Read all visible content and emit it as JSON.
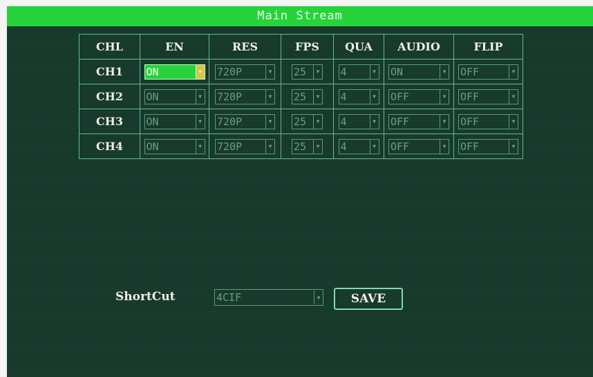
{
  "title": "Main Stream",
  "columns": [
    "CHL",
    "EN",
    "RES",
    "FPS",
    "QUA",
    "AUDIO",
    "FLIP"
  ],
  "rows": [
    {
      "channel": "CH1",
      "en": "ON",
      "res": "720P",
      "fps": "25",
      "qua": "4",
      "audio": "ON",
      "flip": "OFF"
    },
    {
      "channel": "CH2",
      "en": "ON",
      "res": "720P",
      "fps": "25",
      "qua": "4",
      "audio": "OFF",
      "flip": "OFF"
    },
    {
      "channel": "CH3",
      "en": "ON",
      "res": "720P",
      "fps": "25",
      "qua": "4",
      "audio": "OFF",
      "flip": "OFF"
    },
    {
      "channel": "CH4",
      "en": "ON",
      "res": "720P",
      "fps": "25",
      "qua": "4",
      "audio": "OFF",
      "flip": "OFF"
    }
  ],
  "shortcut": {
    "label": "ShortCut",
    "value": "4CIF"
  },
  "save_label": "SAVE",
  "colors": {
    "title_bar": "#27d33a",
    "background": "#183c2e",
    "border": "#63b896",
    "focused": "#27d33a"
  },
  "focused_field": "CH1 EN",
  "icons": {
    "dropdown": "dropdown-arrow-icon"
  }
}
